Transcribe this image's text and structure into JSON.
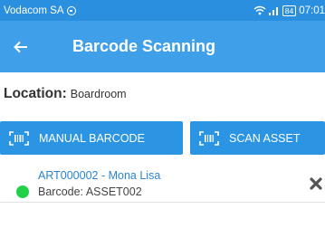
{
  "status_bar": {
    "carrier": "Vodacom SA",
    "carrier_icon": "circle-icon",
    "battery": "84",
    "time": "07:01",
    "bg_color": "#2a8fde"
  },
  "app_bar": {
    "back_icon": "arrow-left-icon",
    "title": "Barcode Scanning",
    "bg_color": "#3f9fe9"
  },
  "location": {
    "label": "Location:",
    "value": "Boardroom"
  },
  "buttons": {
    "manual_label": "MANUAL BARCODE",
    "scan_label": "SCAN ASSET",
    "icon": "barcode-scan-icon",
    "bg_color": "#2b94e3"
  },
  "assets": [
    {
      "title": "ART000002 - Mona Lisa",
      "barcode_label": "Barcode: ASSET002",
      "status_color": "#23d04a",
      "remove_icon": "close-icon"
    }
  ]
}
